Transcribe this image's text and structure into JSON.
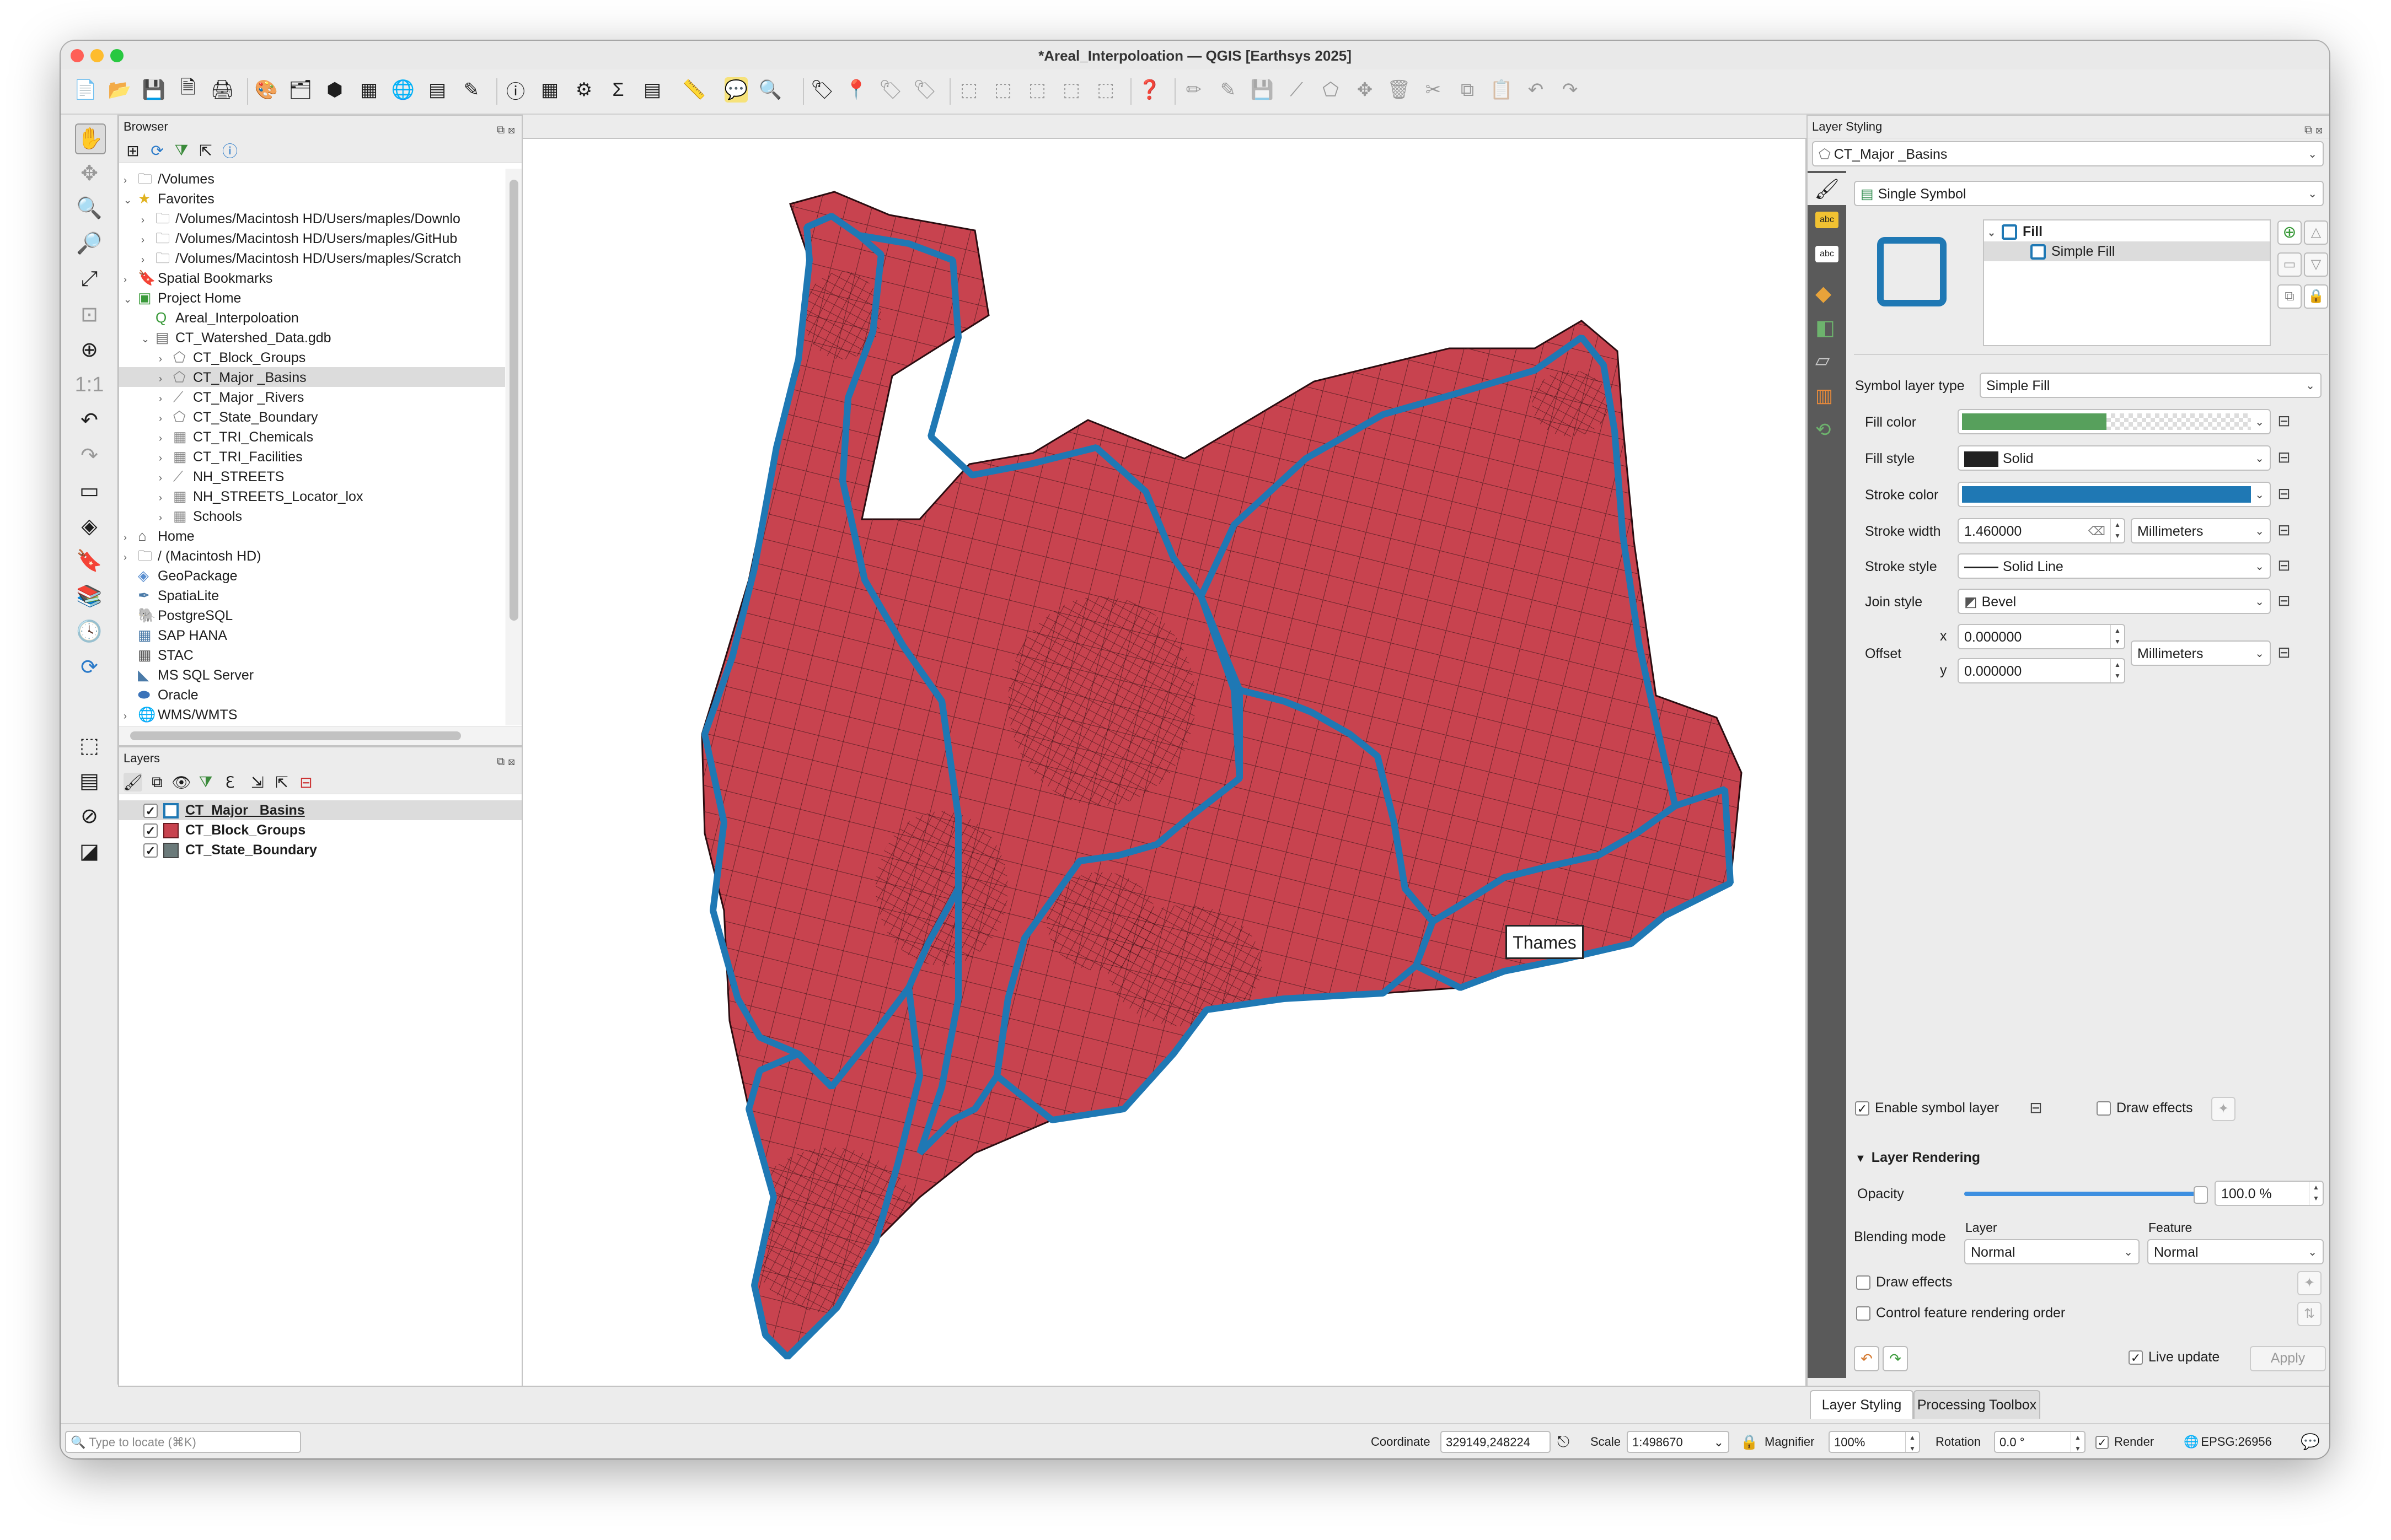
{
  "window": {
    "title": "*Areal_Interpoloation — QGIS [Earthsys 2025]"
  },
  "colors": {
    "fill_red": "#c8434f",
    "stroke_blue": "#1f78b4",
    "fill_green": "#57a05c",
    "accent": "#1f78b4"
  },
  "toolbar_icons": [
    "new-project-icon",
    "open-project-icon",
    "save-project-icon",
    "save-as-icon",
    "print-layout-icon",
    "style-manager-icon",
    "data-source-manager-icon",
    "add-vector-icon",
    "add-raster-icon",
    "add-wms-icon",
    "add-csv-icon",
    "add-spatialite-icon",
    "identify-icon",
    "attribute-table-icon",
    "field-calculator-icon",
    "statistics-icon",
    "open-table-icon",
    "measure-icon",
    "map-tips-icon",
    "zoom-tool-icon",
    "label-icon",
    "label-pin-icon",
    "label-color-icon",
    "label-hide-icon",
    "select-icon",
    "deselect-icon",
    "invert-selection-icon",
    "select-all-icon",
    "select-by-expression-icon",
    "help-icon",
    "edit-pencil-icon",
    "toggle-edit-icon",
    "save-edits-icon",
    "digitize-icon",
    "add-feature-icon",
    "vertex-tool-icon",
    "delete-icon",
    "cut-icon",
    "copy-icon",
    "paste-icon",
    "undo-icon",
    "redo-icon"
  ],
  "browser": {
    "title": "Browser",
    "items": [
      {
        "label": "/Volumes",
        "icon": "folder-icon",
        "depth": 0,
        "arrow": "›"
      },
      {
        "label": "Favorites",
        "icon": "star-icon",
        "depth": 0,
        "arrow": "⌄"
      },
      {
        "label": "/Volumes/Macintosh HD/Users/maples/Downlo",
        "icon": "folder-icon",
        "depth": 1,
        "arrow": "›"
      },
      {
        "label": "/Volumes/Macintosh HD/Users/maples/GitHub",
        "icon": "folder-icon",
        "depth": 1,
        "arrow": "›"
      },
      {
        "label": "/Volumes/Macintosh HD/Users/maples/Scratch",
        "icon": "folder-icon",
        "depth": 1,
        "arrow": "›"
      },
      {
        "label": "Spatial Bookmarks",
        "icon": "bookmark-icon",
        "depth": 0,
        "arrow": "›"
      },
      {
        "label": "Project Home",
        "icon": "project-home-icon",
        "depth": 0,
        "arrow": "⌄"
      },
      {
        "label": "Areal_Interpoloation",
        "icon": "qgis-project-icon",
        "depth": 1,
        "arrow": ""
      },
      {
        "label": "CT_Watershed_Data.gdb",
        "icon": "geodatabase-icon",
        "depth": 1,
        "arrow": "⌄"
      },
      {
        "label": "CT_Block_Groups",
        "icon": "polygon-layer-icon",
        "depth": 2,
        "arrow": "›"
      },
      {
        "label": "CT_Major _Basins",
        "icon": "polygon-layer-icon",
        "depth": 2,
        "arrow": "›"
      },
      {
        "label": "CT_Major _Rivers",
        "icon": "line-layer-icon",
        "depth": 2,
        "arrow": "›"
      },
      {
        "label": "CT_State_Boundary",
        "icon": "polygon-layer-icon",
        "depth": 2,
        "arrow": "›"
      },
      {
        "label": "CT_TRI_Chemicals",
        "icon": "table-icon",
        "depth": 2,
        "arrow": "›"
      },
      {
        "label": "CT_TRI_Facilities",
        "icon": "table-icon",
        "depth": 2,
        "arrow": "›"
      },
      {
        "label": "NH_STREETS",
        "icon": "line-layer-icon",
        "depth": 2,
        "arrow": "›"
      },
      {
        "label": "NH_STREETS_Locator_lox",
        "icon": "table-icon",
        "depth": 2,
        "arrow": "›"
      },
      {
        "label": "Schools",
        "icon": "table-icon",
        "depth": 2,
        "arrow": "›"
      },
      {
        "label": "Home",
        "icon": "home-icon",
        "depth": 0,
        "arrow": "›"
      },
      {
        "label": "/ (Macintosh HD)",
        "icon": "folder-icon",
        "depth": 0,
        "arrow": "›"
      },
      {
        "label": "GeoPackage",
        "icon": "geopackage-icon",
        "depth": 0,
        "arrow": ""
      },
      {
        "label": "SpatiaLite",
        "icon": "spatialite-icon",
        "depth": 0,
        "arrow": ""
      },
      {
        "label": "PostgreSQL",
        "icon": "postgresql-icon",
        "depth": 0,
        "arrow": ""
      },
      {
        "label": "SAP HANA",
        "icon": "sap-hana-icon",
        "depth": 0,
        "arrow": ""
      },
      {
        "label": "STAC",
        "icon": "stac-icon",
        "depth": 0,
        "arrow": ""
      },
      {
        "label": "MS SQL Server",
        "icon": "mssql-icon",
        "depth": 0,
        "arrow": ""
      },
      {
        "label": "Oracle",
        "icon": "oracle-icon",
        "depth": 0,
        "arrow": ""
      },
      {
        "label": "WMS/WMTS",
        "icon": "wms-icon",
        "depth": 0,
        "arrow": "›"
      }
    ]
  },
  "layers": {
    "title": "Layers",
    "items": [
      {
        "label": "CT_Major _Basins",
        "swatch": "outline-blue",
        "checked": true
      },
      {
        "label": "CT_Block_Groups",
        "swatch": "red",
        "checked": true
      },
      {
        "label": "CT_State_Boundary",
        "swatch": "gray",
        "checked": true
      }
    ]
  },
  "map": {
    "label": "Thames"
  },
  "styling": {
    "title": "Layer Styling",
    "layer": "CT_Major _Basins",
    "renderer": "Single Symbol",
    "tree": {
      "fill": "Fill",
      "simple_fill": "Simple Fill"
    },
    "symbol_layer_type_label": "Symbol layer type",
    "symbol_layer_type": "Simple Fill",
    "fill_color_label": "Fill color",
    "fill_style_label": "Fill style",
    "fill_style": "Solid",
    "stroke_color_label": "Stroke color",
    "stroke_width_label": "Stroke width",
    "stroke_width": "1.460000",
    "stroke_width_unit": "Millimeters",
    "stroke_style_label": "Stroke style",
    "stroke_style": "Solid Line",
    "join_style_label": "Join style",
    "join_style": "Bevel",
    "offset_label": "Offset",
    "offset_x_label": "x",
    "offset_x": "0.000000",
    "offset_y_label": "y",
    "offset_y": "0.000000",
    "offset_unit": "Millimeters",
    "enable_symbol_layer": "Enable symbol layer",
    "draw_effects_top": "Draw effects",
    "layer_rendering": "Layer Rendering",
    "opacity_label": "Opacity",
    "opacity": "100.0 %",
    "opacity_fraction": 1.0,
    "blending_label": "Blending mode",
    "blend_layer_label": "Layer",
    "blend_layer": "Normal",
    "blend_feature_label": "Feature",
    "blend_feature": "Normal",
    "draw_effects": "Draw effects",
    "control_order": "Control feature rendering order",
    "live_update": "Live update",
    "apply": "Apply",
    "tabs": [
      "Layer Styling",
      "Processing Toolbox"
    ]
  },
  "statusbar": {
    "locate_placeholder": "Type to locate (⌘K)",
    "coordinate_label": "Coordinate",
    "coordinate": "329149,248224",
    "scale_label": "Scale",
    "scale": "1:498670",
    "magnifier_label": "Magnifier",
    "magnifier": "100%",
    "rotation_label": "Rotation",
    "rotation": "0.0 °",
    "render_label": "Render",
    "crs": "EPSG:26956"
  }
}
